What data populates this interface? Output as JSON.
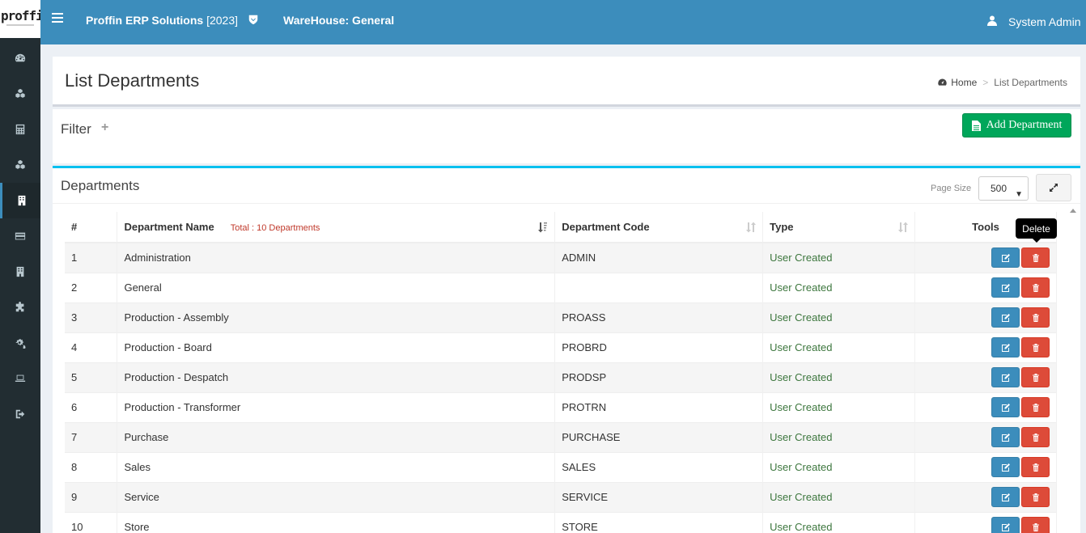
{
  "brand": {
    "logo_text": "proffin"
  },
  "header": {
    "app_title": "Proffin ERP Solutions",
    "app_year": "[2023]",
    "warehouse": "WareHouse: General",
    "user_name": "System Admin"
  },
  "sidebar": {
    "items": [
      {
        "icon": "dashboard-icon"
      },
      {
        "icon": "cubes-icon"
      },
      {
        "icon": "calculator-icon"
      },
      {
        "icon": "cubes-icon"
      },
      {
        "icon": "building-icon",
        "active": true
      },
      {
        "icon": "credit-card-icon"
      },
      {
        "icon": "building-icon"
      },
      {
        "icon": "puzzle-icon"
      },
      {
        "icon": "cogs-icon"
      },
      {
        "icon": "laptop-icon"
      },
      {
        "icon": "sign-out-icon"
      }
    ]
  },
  "page": {
    "title": "List Departments",
    "breadcrumb_home": "Home",
    "breadcrumb_sep": ">",
    "breadcrumb_current": "List Departments"
  },
  "filter": {
    "title": "Filter",
    "toggle": "+"
  },
  "add_button": {
    "label": "Add Department"
  },
  "departments_box": {
    "title": "Departments",
    "page_size_label": "Page Size",
    "page_size_value": "500"
  },
  "table": {
    "headers": {
      "num": "#",
      "name": "Department Name",
      "total": "Total : 10 Departments",
      "code": "Department Code",
      "type": "Type",
      "tools": "Tools"
    },
    "rows": [
      {
        "num": "1",
        "name": "Administration",
        "code": "ADMIN",
        "type": "User Created"
      },
      {
        "num": "2",
        "name": "General",
        "code": "",
        "type": "User Created"
      },
      {
        "num": "3",
        "name": "Production - Assembly",
        "code": "PROASS",
        "type": "User Created"
      },
      {
        "num": "4",
        "name": "Production - Board",
        "code": "PROBRD",
        "type": "User Created"
      },
      {
        "num": "5",
        "name": "Production - Despatch",
        "code": "PRODSP",
        "type": "User Created"
      },
      {
        "num": "6",
        "name": "Production - Transformer",
        "code": "PROTRN",
        "type": "User Created"
      },
      {
        "num": "7",
        "name": "Purchase",
        "code": "PURCHASE",
        "type": "User Created"
      },
      {
        "num": "8",
        "name": "Sales",
        "code": "SALES",
        "type": "User Created"
      },
      {
        "num": "9",
        "name": "Service",
        "code": "SERVICE",
        "type": "User Created"
      },
      {
        "num": "10",
        "name": "Store",
        "code": "STORE",
        "type": "User Created"
      }
    ]
  },
  "tooltip": {
    "text": "Delete"
  },
  "colors": {
    "header_bg": "#3c8dbc",
    "sidebar_bg": "#222d32",
    "add_button": "#00a65a",
    "edit_button": "#3c8dbc",
    "delete_button": "#dd4b39",
    "type_text": "#3c763d",
    "box_accent": "#00c0ef"
  }
}
